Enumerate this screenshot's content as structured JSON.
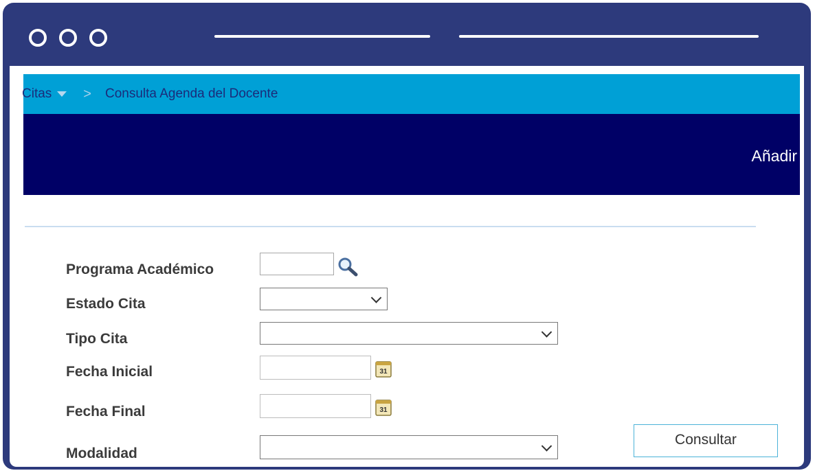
{
  "breadcrumb": {
    "parent": "Citas",
    "separator": ">",
    "current": "Consulta Agenda del Docente"
  },
  "header": {
    "add_label": "Añadir"
  },
  "form": {
    "programa_label": "Programa Académico",
    "programa_value": "",
    "estado_label": "Estado Cita",
    "estado_value": "",
    "tipo_label": "Tipo Cita",
    "tipo_value": "",
    "fecha_inicial_label": "Fecha Inicial",
    "fecha_inicial_value": "",
    "fecha_final_label": "Fecha Final",
    "fecha_final_value": "",
    "modalidad_label": "Modalidad",
    "modalidad_value": "",
    "calendar_icon_text": "31"
  },
  "actions": {
    "consultar_label": "Consultar"
  },
  "icons": [
    "window-dot-icon",
    "chevron-down-icon",
    "search-icon",
    "calendar-icon"
  ],
  "colors": {
    "frame": "#2d3a7c",
    "breadcrumb_bg": "#00a0d6",
    "header_bg": "#000066",
    "label_text": "#3b3b3b",
    "button_border": "#4bb3d8"
  }
}
